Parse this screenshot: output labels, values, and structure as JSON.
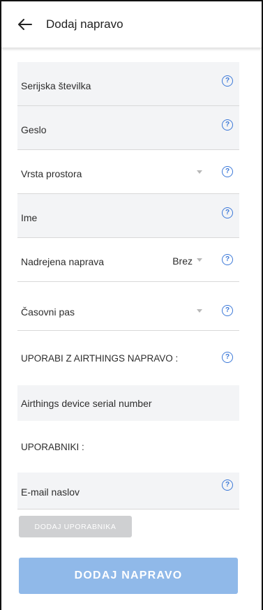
{
  "header": {
    "title": "Dodaj napravo",
    "back_icon": "arrow-left-icon"
  },
  "form": {
    "serial_number": {
      "label": "Serijska številka"
    },
    "password": {
      "label": "Geslo"
    },
    "space_type": {
      "label": "Vrsta prostora",
      "value": ""
    },
    "name": {
      "label": "Ime"
    },
    "parent_device": {
      "label": "Nadrejena naprava",
      "value": "Brez"
    },
    "timezone": {
      "label": "Časovni pas",
      "value": ""
    },
    "airthings_section": {
      "label": "UPORABI Z AIRTHINGS NAPRAVO :"
    },
    "airthings_serial": {
      "label": "Airthings device serial number"
    },
    "users_section": {
      "label": "UPORABNIKI :"
    },
    "email": {
      "label": "E-mail naslov"
    }
  },
  "buttons": {
    "add_user": "DODAJ UPORABNIKA",
    "add_device": "DODAJ NAPRAVO"
  },
  "colors": {
    "accent": "#3b78d8",
    "primary_button": "#90b9e9",
    "disabled_button": "#cfd0d2",
    "field_background": "#f3f4f6"
  }
}
